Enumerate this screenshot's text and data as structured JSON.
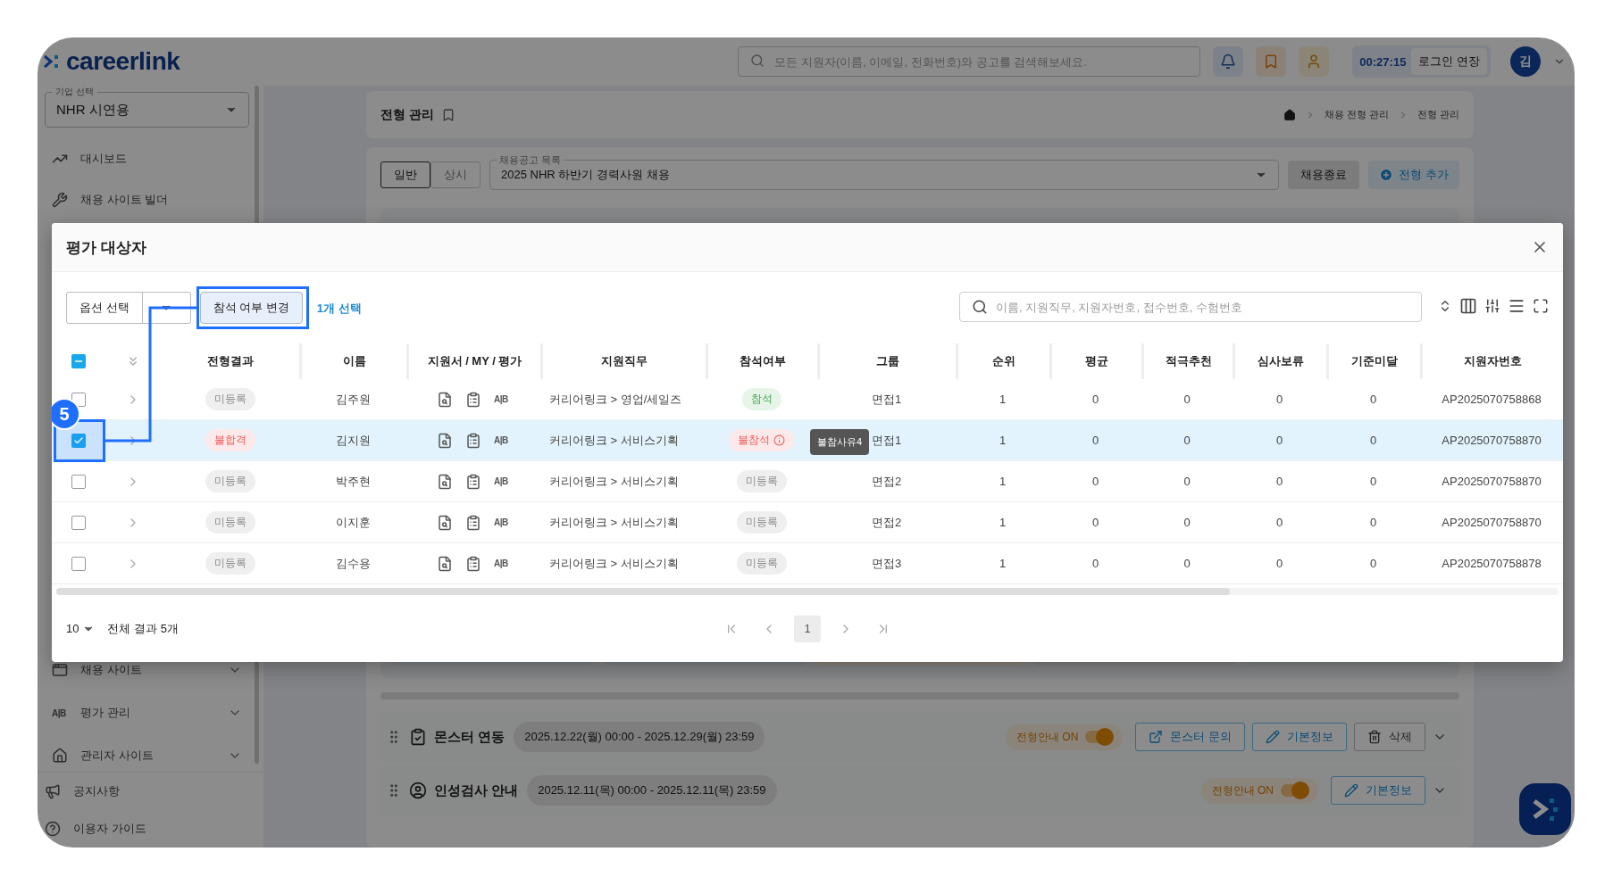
{
  "header": {
    "logo": "careerlink",
    "search_placeholder": "모든 지원자(이름, 이메일, 전화번호)와 공고를 검색해보세요.",
    "timer": "00:27:15",
    "extend_button": "로그인 연장",
    "avatar": "김"
  },
  "sidebar": {
    "company_label": "기업 선택",
    "company_value": "NHR 시연용",
    "top_items": [
      {
        "label": "대시보드",
        "kind": "dashboard"
      },
      {
        "label": "채용 사이트 빌더",
        "kind": "builder"
      }
    ],
    "menu_items": [
      {
        "label": "채용 사이트",
        "kind": "site",
        "expanded": false
      },
      {
        "label": "평가 관리",
        "kind": "eval",
        "icon_text": "A|B",
        "expanded": false
      },
      {
        "label": "관리자 사이트",
        "kind": "admin",
        "expanded": false
      }
    ],
    "footer_items": [
      {
        "label": "공지사항",
        "kind": "notice"
      },
      {
        "label": "이용자 가이드",
        "kind": "guide"
      }
    ]
  },
  "page": {
    "title": "전형 관리",
    "breadcrumb": [
      "채용 전형 관리",
      "전형 관리"
    ],
    "tabs": [
      {
        "label": "일반",
        "selected": true
      },
      {
        "label": "상시",
        "selected": false
      }
    ],
    "posting_label": "채용공고 목록",
    "posting_value": "2025 NHR 하반기 경력사원 채용",
    "close_button": "채용종료",
    "add_button": "전형 추가"
  },
  "stages": [
    {
      "kind": "monster",
      "title": "몬스터 연동",
      "period": "2025.12.22(월) 00:00 - 2025.12.29(월) 23:59",
      "guide": {
        "label": "전형안내 ON",
        "on": true
      },
      "actions": [
        {
          "kind": "external",
          "label": "몬스터 문의"
        },
        {
          "kind": "edit",
          "label": "기본정보"
        },
        {
          "kind": "delete",
          "label": "삭제"
        }
      ]
    },
    {
      "kind": "aptitude",
      "title": "인성검사 안내",
      "period": "2025.12.11(목) 00:00 - 2025.12.11(목) 23:59",
      "guide": {
        "label": "전형안내 ON",
        "on": true
      },
      "actions": [
        {
          "kind": "edit",
          "label": "기본정보"
        }
      ]
    }
  ],
  "modal": {
    "title": "평가 대상자",
    "option_select": "옵션 선택",
    "change_button": "참석 여부 변경",
    "selection_count": "1개 선택",
    "search_placeholder": "이름, 지원직무, 지원자번호, 접수번호, 수험번호",
    "columns": [
      "전형결과",
      "이름",
      "지원서 / MY / 평가",
      "지원직무",
      "참석여부",
      "그룹",
      "순위",
      "평균",
      "적극추천",
      "심사보류",
      "기준미달",
      "지원자번호"
    ],
    "rows": [
      {
        "checked": false,
        "result": {
          "label": "미등록",
          "kind": "none"
        },
        "name": "김주원",
        "eval": "A|B",
        "job": "커리어링크 > 영업/세일즈",
        "attendance": {
          "label": "참석",
          "kind": "present"
        },
        "group": "면접1",
        "rank": "1",
        "average": "0",
        "recommend": "0",
        "hold": "0",
        "below": "0",
        "applicant_no": "AP2025070758868"
      },
      {
        "checked": true,
        "result": {
          "label": "불합격",
          "kind": "fail"
        },
        "name": "김지원",
        "eval": "A|B",
        "job": "커리어링크 > 서비스기획",
        "attendance": {
          "label": "불참석",
          "kind": "absent",
          "reason": "불참사유4"
        },
        "group": "면접1",
        "rank": "1",
        "average": "0",
        "recommend": "0",
        "hold": "0",
        "below": "0",
        "applicant_no": "AP2025070758870"
      },
      {
        "checked": false,
        "result": {
          "label": "미등록",
          "kind": "none"
        },
        "name": "박주현",
        "eval": "A|B",
        "job": "커리어링크 > 서비스기획",
        "attendance": {
          "label": "미등록",
          "kind": "none"
        },
        "group": "면접2",
        "rank": "1",
        "average": "0",
        "recommend": "0",
        "hold": "0",
        "below": "0",
        "applicant_no": "AP2025070758870"
      },
      {
        "checked": false,
        "result": {
          "label": "미등록",
          "kind": "none"
        },
        "name": "이지훈",
        "eval": "A|B",
        "job": "커리어링크 > 서비스기획",
        "attendance": {
          "label": "미등록",
          "kind": "none"
        },
        "group": "면접2",
        "rank": "1",
        "average": "0",
        "recommend": "0",
        "hold": "0",
        "below": "0",
        "applicant_no": "AP2025070758870"
      },
      {
        "checked": false,
        "result": {
          "label": "미등록",
          "kind": "none"
        },
        "name": "김수용",
        "eval": "A|B",
        "job": "커리어링크 > 서비스기획",
        "attendance": {
          "label": "미등록",
          "kind": "none"
        },
        "group": "면접3",
        "rank": "1",
        "average": "0",
        "recommend": "0",
        "hold": "0",
        "below": "0",
        "applicant_no": "AP2025070758878"
      }
    ],
    "select_all": {
      "checked": false,
      "partial": true
    },
    "page_size": "10",
    "total": "전체 결과 5개",
    "pages": [
      {
        "label": "1",
        "selected": true
      }
    ]
  },
  "annotation": {
    "number": "5"
  }
}
